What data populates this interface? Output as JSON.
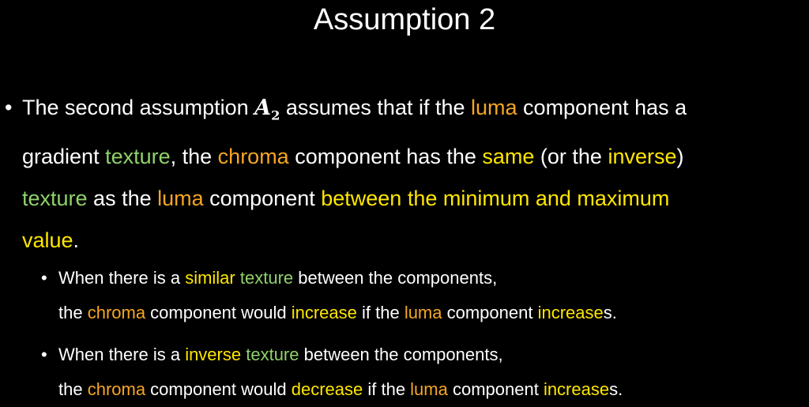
{
  "title": "Assumption 2",
  "colors": {
    "background": "#000000",
    "text": "#ffffff",
    "green": "#8fd16a",
    "orange": "#f5a623",
    "yellow": "#ffe600"
  },
  "bullet_main": {
    "marker": "•",
    "lines": [
      [
        {
          "t": "The second assumption ",
          "c": "white"
        },
        {
          "t": "A",
          "c": "math"
        },
        {
          "t": "2",
          "c": "mathsub"
        },
        {
          "t": " assumes that if the ",
          "c": "white"
        },
        {
          "t": "luma",
          "c": "orange"
        },
        {
          "t": " component has a",
          "c": "white"
        }
      ],
      [
        {
          "t": "gradient ",
          "c": "white"
        },
        {
          "t": "texture",
          "c": "green"
        },
        {
          "t": ", the ",
          "c": "white"
        },
        {
          "t": "chroma",
          "c": "orange"
        },
        {
          "t": " component has the ",
          "c": "white"
        },
        {
          "t": "same",
          "c": "yellow"
        },
        {
          "t": " (or the ",
          "c": "white"
        },
        {
          "t": "inverse",
          "c": "yellow"
        },
        {
          "t": ")",
          "c": "white"
        }
      ],
      [
        {
          "t": "texture",
          "c": "green"
        },
        {
          "t": " as the ",
          "c": "white"
        },
        {
          "t": "luma",
          "c": "orange"
        },
        {
          "t": " component ",
          "c": "white"
        },
        {
          "t": "between the minimum and maximum",
          "c": "yellow"
        }
      ],
      [
        {
          "t": "value",
          "c": "yellow"
        },
        {
          "t": ".",
          "c": "white"
        }
      ]
    ]
  },
  "sub_bullets": [
    {
      "marker": "•",
      "lines": [
        [
          {
            "t": "When there is a ",
            "c": "white"
          },
          {
            "t": "similar",
            "c": "yellow"
          },
          {
            "t": " ",
            "c": "white"
          },
          {
            "t": "texture",
            "c": "green"
          },
          {
            "t": " between the components,",
            "c": "white"
          }
        ],
        [
          {
            "t": "the ",
            "c": "white"
          },
          {
            "t": "chroma",
            "c": "orange"
          },
          {
            "t": " component would ",
            "c": "white"
          },
          {
            "t": "increase",
            "c": "yellow"
          },
          {
            "t": " if the ",
            "c": "white"
          },
          {
            "t": "luma",
            "c": "orange"
          },
          {
            "t": " component ",
            "c": "white"
          },
          {
            "t": "increase",
            "c": "yellow"
          },
          {
            "t": "s.",
            "c": "white"
          }
        ]
      ]
    },
    {
      "marker": "•",
      "lines": [
        [
          {
            "t": "When there is a ",
            "c": "white"
          },
          {
            "t": "inverse",
            "c": "yellow"
          },
          {
            "t": " ",
            "c": "white"
          },
          {
            "t": "texture",
            "c": "green"
          },
          {
            "t": " between the components,",
            "c": "white"
          }
        ],
        [
          {
            "t": "the ",
            "c": "white"
          },
          {
            "t": "chroma",
            "c": "orange"
          },
          {
            "t": " component would ",
            "c": "white"
          },
          {
            "t": "decrease",
            "c": "yellow"
          },
          {
            "t": " if the ",
            "c": "white"
          },
          {
            "t": "luma",
            "c": "orange"
          },
          {
            "t": " component ",
            "c": "white"
          },
          {
            "t": "increase",
            "c": "yellow"
          },
          {
            "t": "s.",
            "c": "white"
          }
        ]
      ]
    }
  ]
}
